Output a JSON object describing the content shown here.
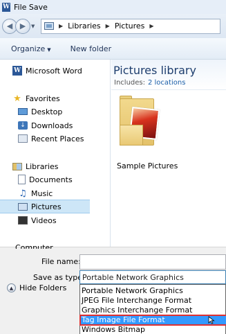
{
  "window": {
    "title": "File Save",
    "app_icon": "W"
  },
  "nav": {
    "back_icon": "back-arrow-icon",
    "forward_icon": "forward-arrow-icon",
    "address": [
      "Libraries",
      "Pictures"
    ]
  },
  "toolbar": {
    "organize_label": "Organize",
    "new_folder_label": "New folder"
  },
  "sidebar": {
    "items": [
      {
        "label": "Microsoft Word",
        "icon": "word-icon"
      },
      {
        "label": "Favorites",
        "icon": "star-icon"
      },
      {
        "label": "Desktop",
        "icon": "desktop-icon"
      },
      {
        "label": "Downloads",
        "icon": "downloads-icon"
      },
      {
        "label": "Recent Places",
        "icon": "recent-places-icon"
      },
      {
        "label": "Libraries",
        "icon": "libraries-icon"
      },
      {
        "label": "Documents",
        "icon": "documents-icon"
      },
      {
        "label": "Music",
        "icon": "music-icon"
      },
      {
        "label": "Pictures",
        "icon": "pictures-icon"
      },
      {
        "label": "Videos",
        "icon": "videos-icon"
      }
    ],
    "cut_off_label": "Computer"
  },
  "main": {
    "title": "Pictures library",
    "includes_label": "Includes:",
    "includes_link": "2 locations",
    "folder_label": "Sample Pictures"
  },
  "bottom": {
    "file_name_label": "File name:",
    "file_name_value": "",
    "save_type_label": "Save as type:",
    "save_type_value": "Portable Network Graphics",
    "hide_folders_label": "Hide Folders",
    "type_options": [
      "Portable Network Graphics",
      "JPEG File Interchange Format",
      "Graphics Interchange Format",
      "Tag Image File Format",
      "Windows Bitmap"
    ]
  },
  "colors": {
    "selection": "#3399ff",
    "highlight_outline": "#e03030",
    "library_title": "#1e3e6e"
  }
}
